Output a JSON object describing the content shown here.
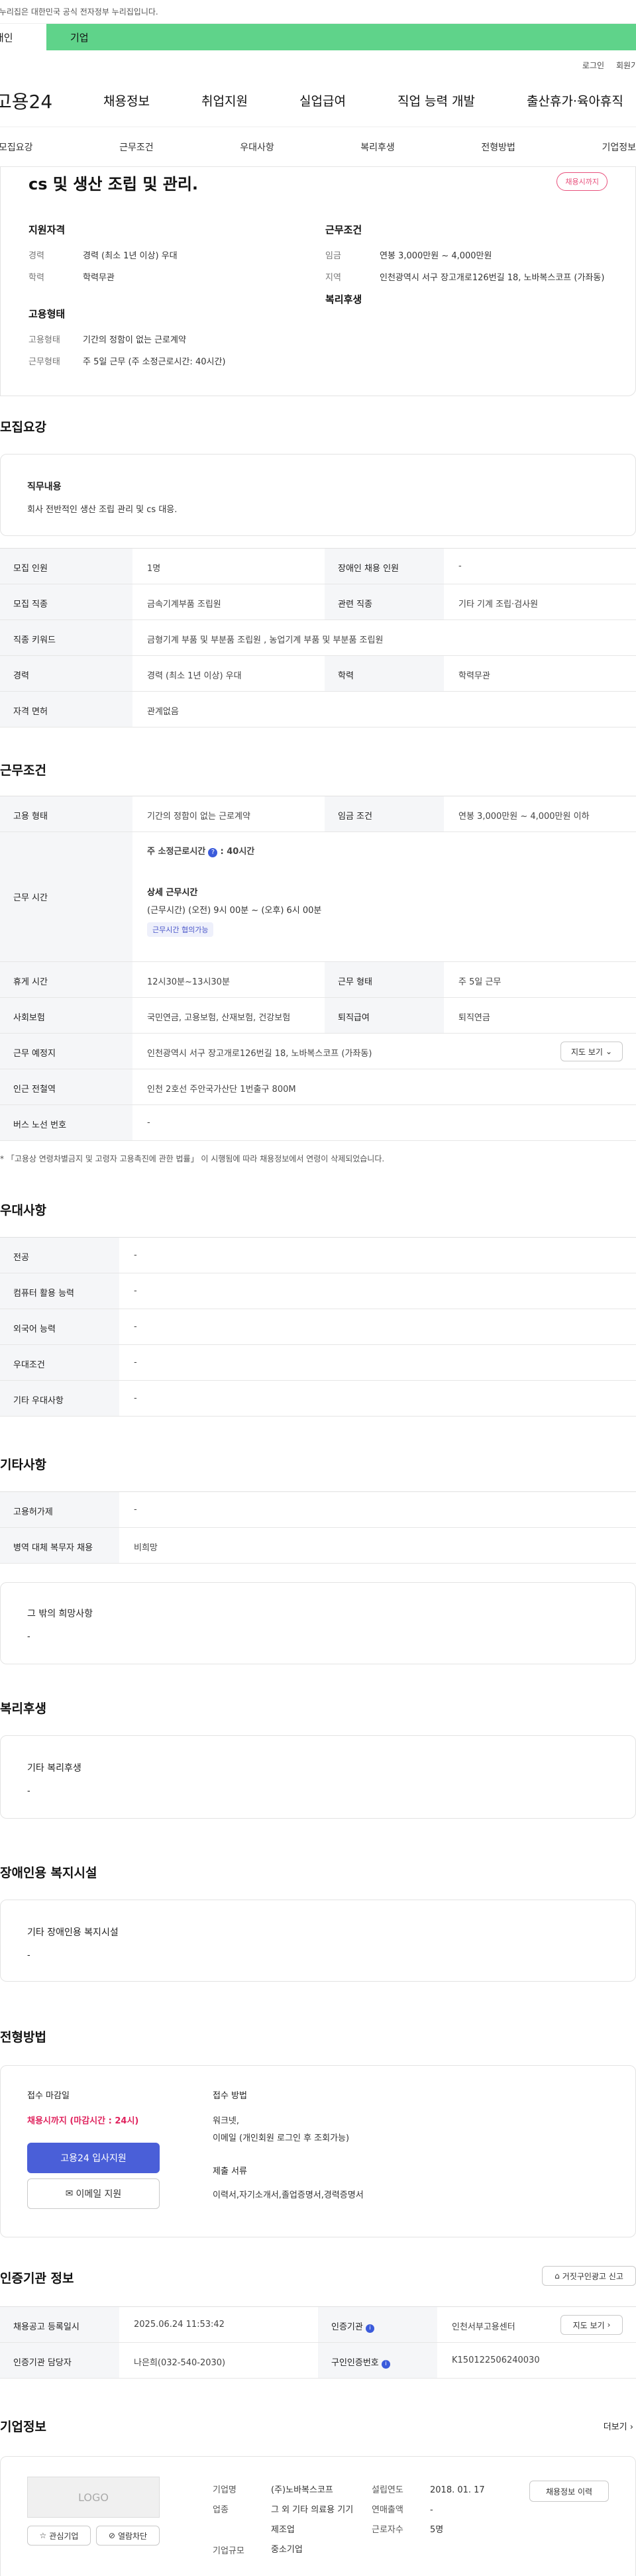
{
  "gov_banner": "이 누리집은 대한민국 공식 전자정부 누리집입니다.",
  "audience_tabs": [
    "개인",
    "기업"
  ],
  "util": [
    "로그인",
    "회원가입"
  ],
  "logo": "고용24",
  "gnb": [
    "채용정보",
    "취업지원",
    "실업급여",
    "직업 능력 개발",
    "출산휴가·육아휴직"
  ],
  "subnav": [
    "모집요강",
    "근무조건",
    "우대사항",
    "복리후생",
    "전형방법",
    "기업정보"
  ],
  "job": {
    "title": "cs 및 생산 조립 및 관리.",
    "badge": "채용시까지",
    "qual_title": "지원자격",
    "career_k": "경력",
    "career_v": "경력 (최소 1년 이상) 우대",
    "edu_k": "학력",
    "edu_v": "학력무관",
    "emp_title": "고용형태",
    "emp_k": "고용형태",
    "emp_v": "기간의 정함이 없는 근로계약",
    "work_k": "근무형태",
    "work_v": "주 5일 근무 (주 소정근로시간: 40시간)",
    "cond_title": "근무조건",
    "wage_k": "임금",
    "wage_v": "연봉 3,000만원 ~ 4,000만원",
    "area_k": "지역",
    "area_v": "인천광역시 서구 장고개로126번길 18, 노바복스코프 (가좌동)",
    "welfare_title": "복리후생"
  },
  "recruit": {
    "title": "모집요강",
    "duty_label": "직무내용",
    "duty_text": "회사 전반적인 생산 조립 관리 및 cs 대응.",
    "rows": [
      [
        "모집 인원",
        "1명",
        "장애인 채용 인원",
        "-"
      ],
      [
        "모집 직종",
        "금속기계부품 조립원",
        "관련 직종",
        "기타 기계 조립·검사원"
      ],
      [
        "직종 키워드",
        "금형기계 부품 및 부분품 조립원 , 농업기계 부품 및 부분품 조립원"
      ],
      [
        "경력",
        "경력 (최소 1년 이상) 우대",
        "학력",
        "학력무관"
      ],
      [
        "자격 면허",
        "관계없음"
      ]
    ]
  },
  "cond": {
    "title": "근무조건",
    "emp": [
      "고용 형태",
      "기간의 정함이 없는 근로계약",
      "임금 조건",
      "연봉 3,000만원 ~ 4,000만원 이하"
    ],
    "hours_label": "근무 시간",
    "weekly": "주 소정근로시간",
    "weekly_v": ": 40시간",
    "detail_label": "상세 근무시간",
    "detail_v": "(근무시간) (오전) 9시 00분 ~ (오후) 6시 00분",
    "tag": "근무시간 협의가능",
    "rows": [
      [
        "휴게 시간",
        "12시30분~13시30분",
        "근무 형태",
        "주 5일 근무"
      ],
      [
        "사회보험",
        "국민연금, 고용보험, 산재보험, 건강보험",
        "퇴직급여",
        "퇴직연금"
      ]
    ],
    "place_k": "근무 예정지",
    "place_v": "인천광역시 서구 장고개로126번길 18, 노바복스코프 (가좌동)",
    "map_btn": "지도 보기",
    "subway_k": "인근 전철역",
    "subway_v": "인천 2호선 주안국가산단 1번출구 800M",
    "bus_k": "버스 노선 번호",
    "bus_v": "-",
    "note": "* 「고용상 연령차별금지 및 고령자 고용촉진에 관한 법률」 이 시행됨에 따라 채용정보에서 연령이 삭제되었습니다."
  },
  "pref": {
    "title": "우대사항",
    "rows": [
      [
        "전공",
        "-"
      ],
      [
        "컴퓨터 활용 능력",
        "-"
      ],
      [
        "외국어 능력",
        "-"
      ],
      [
        "우대조건",
        "-"
      ],
      [
        "기타 우대사항",
        "-"
      ]
    ]
  },
  "etc": {
    "title": "기타사항",
    "rows": [
      [
        "고용허가제",
        "-"
      ],
      [
        "병역 대체 복무자 채용",
        "비희망"
      ]
    ],
    "other_label": "그 밖의 희망사항",
    "other_v": "-"
  },
  "welfare": {
    "title": "복리후생",
    "label": "기타 복리후생",
    "v": "-"
  },
  "disabled": {
    "title": "장애인용 복지시설",
    "label": "기타 장애인용 복지시설",
    "v": "-"
  },
  "process": {
    "title": "전형방법",
    "deadline_label": "접수 마감일",
    "deadline_v": "채용시까지 (마감시간 : 24시)",
    "apply_btn": "고용24 입사지원",
    "email_btn": "이메일 지원",
    "method_label": "접수 방법",
    "method_v1": "워크넷,",
    "method_v2": "이메일 (개인회원 로그인 후 조회가능)",
    "docs_label": "제출 서류",
    "docs_v": "이력서,자기소개서,졸업증명서,경력증명서"
  },
  "cert": {
    "title": "인증기관 정보",
    "report_btn": "거짓구인광고 신고",
    "reg_k": "채용공고 등록일시",
    "reg_v": "2025.06.24 11:53:42",
    "agency_k": "인증기관",
    "agency_v": "인천서부고용센터",
    "detail_btn": "지도 보기",
    "mgr_k": "인증기관 담당자",
    "mgr_v": "나은희(032-540-2030)",
    "no_k": "구인인증번호",
    "no_v": "K150122506240030"
  },
  "company": {
    "title": "기업정보",
    "more": "더보기",
    "logo": "LOGO",
    "fav_btn": "관심기업",
    "block_btn": "열람차단",
    "name_k": "기업명",
    "name_v": "(주)노바복스코프",
    "est_k": "설립연도",
    "est_v": "2018. 01. 17",
    "ind_k": "업종",
    "ind_v": "그 외 기타 의료용 기기 제조업",
    "sales_k": "연매출액",
    "sales_v": "-",
    "staff_k": "근로자수",
    "staff_v": "5명",
    "size_k": "기업규모",
    "size_v": "중소기업",
    "jobs_btn": "채용정보 이력"
  },
  "accent": {
    "green": "#5fd38a",
    "blue": "#4a5fd8",
    "pink": "#e8507c",
    "red": "#e0245e"
  }
}
